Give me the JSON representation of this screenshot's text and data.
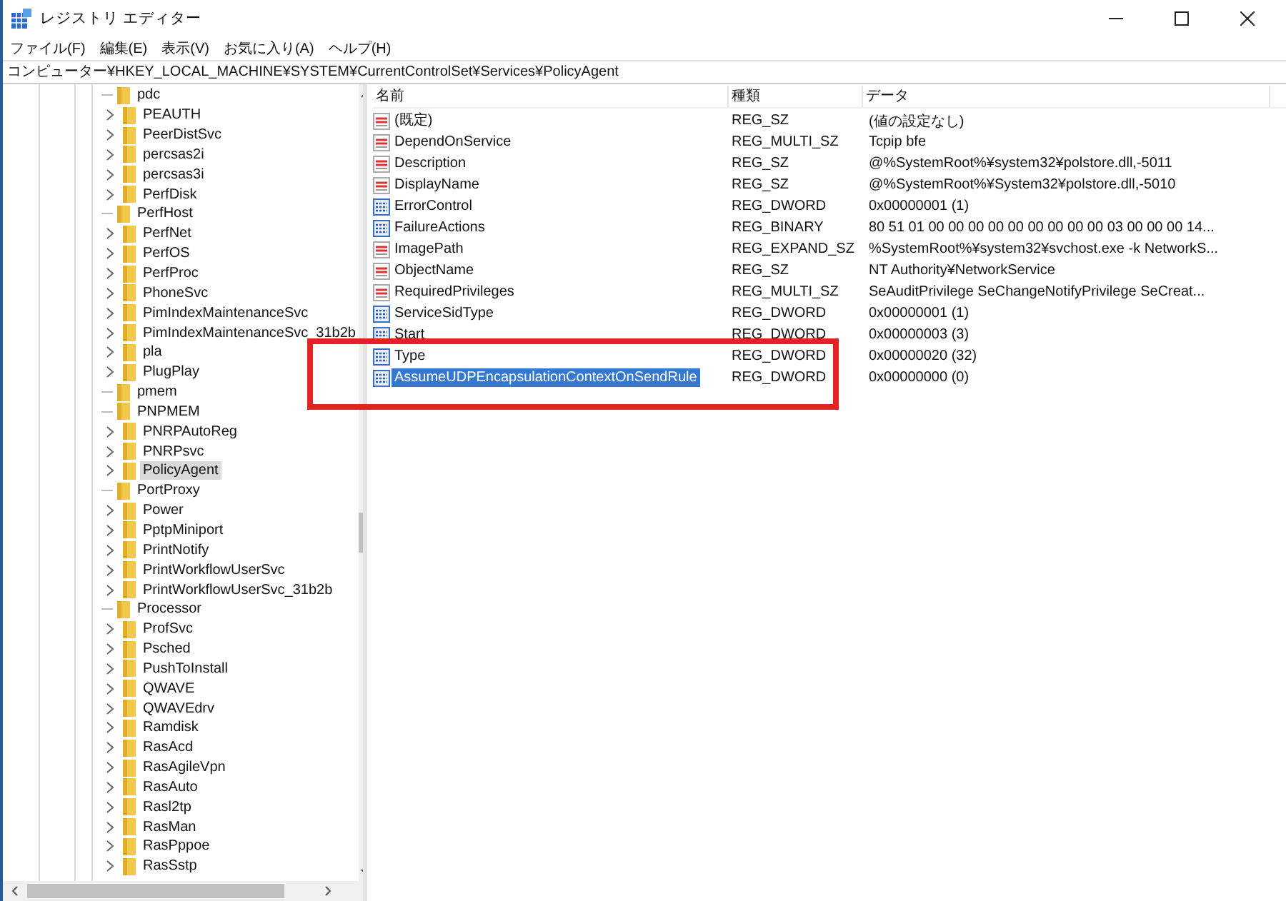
{
  "window": {
    "title": "レジストリ エディター"
  },
  "menu": [
    "ファイル(F)",
    "編集(E)",
    "表示(V)",
    "お気に入り(A)",
    "ヘルプ(H)"
  ],
  "address": "コンピューター¥HKEY_LOCAL_MACHINE¥SYSTEM¥CurrentControlSet¥Services¥PolicyAgent",
  "tree": [
    {
      "label": "pdc",
      "expandable": false,
      "selected": false
    },
    {
      "label": "PEAUTH",
      "expandable": true,
      "selected": false
    },
    {
      "label": "PeerDistSvc",
      "expandable": true,
      "selected": false
    },
    {
      "label": "percsas2i",
      "expandable": true,
      "selected": false
    },
    {
      "label": "percsas3i",
      "expandable": true,
      "selected": false
    },
    {
      "label": "PerfDisk",
      "expandable": true,
      "selected": false
    },
    {
      "label": "PerfHost",
      "expandable": false,
      "selected": false
    },
    {
      "label": "PerfNet",
      "expandable": true,
      "selected": false
    },
    {
      "label": "PerfOS",
      "expandable": true,
      "selected": false
    },
    {
      "label": "PerfProc",
      "expandable": true,
      "selected": false
    },
    {
      "label": "PhoneSvc",
      "expandable": true,
      "selected": false
    },
    {
      "label": "PimIndexMaintenanceSvc",
      "expandable": true,
      "selected": false
    },
    {
      "label": "PimIndexMaintenanceSvc_31b2b",
      "expandable": true,
      "selected": false
    },
    {
      "label": "pla",
      "expandable": true,
      "selected": false
    },
    {
      "label": "PlugPlay",
      "expandable": true,
      "selected": false
    },
    {
      "label": "pmem",
      "expandable": false,
      "selected": false
    },
    {
      "label": "PNPMEM",
      "expandable": false,
      "selected": false
    },
    {
      "label": "PNRPAutoReg",
      "expandable": true,
      "selected": false
    },
    {
      "label": "PNRPsvc",
      "expandable": true,
      "selected": false
    },
    {
      "label": "PolicyAgent",
      "expandable": true,
      "selected": true
    },
    {
      "label": "PortProxy",
      "expandable": false,
      "selected": false
    },
    {
      "label": "Power",
      "expandable": true,
      "selected": false
    },
    {
      "label": "PptpMiniport",
      "expandable": true,
      "selected": false
    },
    {
      "label": "PrintNotify",
      "expandable": true,
      "selected": false
    },
    {
      "label": "PrintWorkflowUserSvc",
      "expandable": true,
      "selected": false
    },
    {
      "label": "PrintWorkflowUserSvc_31b2b",
      "expandable": true,
      "selected": false
    },
    {
      "label": "Processor",
      "expandable": false,
      "selected": false
    },
    {
      "label": "ProfSvc",
      "expandable": true,
      "selected": false
    },
    {
      "label": "Psched",
      "expandable": true,
      "selected": false
    },
    {
      "label": "PushToInstall",
      "expandable": true,
      "selected": false
    },
    {
      "label": "QWAVE",
      "expandable": true,
      "selected": false
    },
    {
      "label": "QWAVEdrv",
      "expandable": true,
      "selected": false
    },
    {
      "label": "Ramdisk",
      "expandable": true,
      "selected": false
    },
    {
      "label": "RasAcd",
      "expandable": true,
      "selected": false
    },
    {
      "label": "RasAgileVpn",
      "expandable": true,
      "selected": false
    },
    {
      "label": "RasAuto",
      "expandable": true,
      "selected": false
    },
    {
      "label": "Rasl2tp",
      "expandable": true,
      "selected": false
    },
    {
      "label": "RasMan",
      "expandable": true,
      "selected": false
    },
    {
      "label": "RasPppoe",
      "expandable": true,
      "selected": false
    },
    {
      "label": "RasSstp",
      "expandable": true,
      "selected": false
    }
  ],
  "table": {
    "columns": [
      "名前",
      "種類",
      "データ"
    ],
    "rows": [
      {
        "kind": "string",
        "name": "(既定)",
        "type": "REG_SZ",
        "data": "(値の設定なし)",
        "selected": false
      },
      {
        "kind": "string",
        "name": "DependOnService",
        "type": "REG_MULTI_SZ",
        "data": "Tcpip bfe",
        "selected": false
      },
      {
        "kind": "string",
        "name": "Description",
        "type": "REG_SZ",
        "data": "@%SystemRoot%¥system32¥polstore.dll,-5011",
        "selected": false
      },
      {
        "kind": "string",
        "name": "DisplayName",
        "type": "REG_SZ",
        "data": "@%SystemRoot%¥System32¥polstore.dll,-5010",
        "selected": false
      },
      {
        "kind": "binary",
        "name": "ErrorControl",
        "type": "REG_DWORD",
        "data": "0x00000001 (1)",
        "selected": false
      },
      {
        "kind": "binary",
        "name": "FailureActions",
        "type": "REG_BINARY",
        "data": "80 51 01 00 00 00 00 00 00 00 00 00 03 00 00 00 14...",
        "selected": false
      },
      {
        "kind": "string",
        "name": "ImagePath",
        "type": "REG_EXPAND_SZ",
        "data": "%SystemRoot%¥system32¥svchost.exe -k NetworkS...",
        "selected": false
      },
      {
        "kind": "string",
        "name": "ObjectName",
        "type": "REG_SZ",
        "data": "NT Authority¥NetworkService",
        "selected": false
      },
      {
        "kind": "string",
        "name": "RequiredPrivileges",
        "type": "REG_MULTI_SZ",
        "data": "SeAuditPrivilege SeChangeNotifyPrivilege SeCreat...",
        "selected": false
      },
      {
        "kind": "binary",
        "name": "ServiceSidType",
        "type": "REG_DWORD",
        "data": "0x00000001 (1)",
        "selected": false
      },
      {
        "kind": "binary",
        "name": "Start",
        "type": "REG_DWORD",
        "data": "0x00000003 (3)",
        "selected": false
      },
      {
        "kind": "binary",
        "name": "Type",
        "type": "REG_DWORD",
        "data": "0x00000020 (32)",
        "selected": false
      },
      {
        "kind": "binary",
        "name": "AssumeUDPEncapsulationContextOnSendRule",
        "type": "REG_DWORD",
        "data": "0x00000000 (0)",
        "selected": true
      }
    ]
  }
}
